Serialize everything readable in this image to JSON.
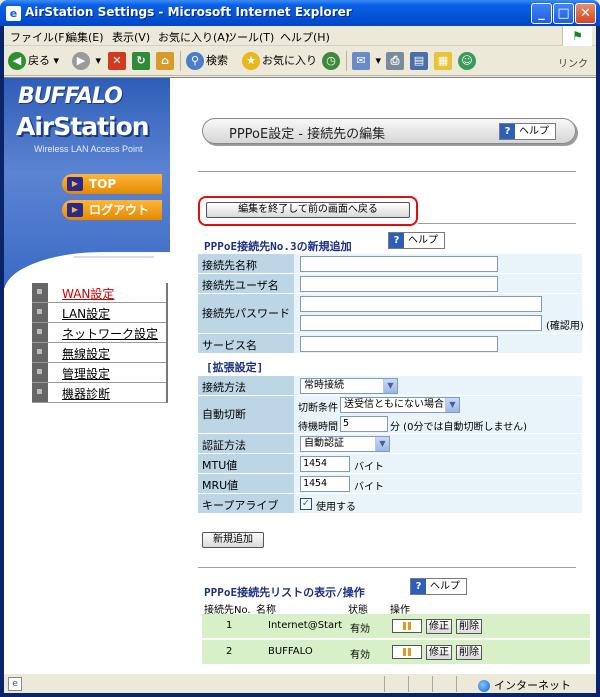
{
  "window": {
    "title": "AirStation Settings - Microsoft Internet Explorer",
    "icon": "ie-icon",
    "controls": [
      "minimize",
      "maximize",
      "close"
    ]
  },
  "menubar": {
    "items": [
      "ファイル(F)",
      "編集(E)",
      "表示(V)",
      "お気に入り(A)",
      "ツール(T)",
      "ヘルプ(H)"
    ]
  },
  "toolbar": {
    "back": "戻る",
    "search": "検索",
    "favorites": "お気に入り",
    "links": "リンク"
  },
  "sidebar": {
    "brand": "BUFFALO",
    "product": "AirStation",
    "tagline": "Wireless LAN Access Point",
    "top_button": "TOP",
    "logout_button": "ログアウト",
    "nav": [
      "WAN設定",
      "LAN設定",
      "ネットワーク設定",
      "無線設定",
      "管理設定",
      "機器診断"
    ],
    "active_index": 0
  },
  "header": {
    "title": "PPPoE設定 - 接続先の編集",
    "help": "ヘルプ"
  },
  "back_button": "編集を終了して前の画面へ戻る",
  "new_entry": {
    "title": "PPPoE接続先No.3の新規追加",
    "help": "ヘルプ",
    "fields": {
      "name_label": "接続先名称",
      "name_value": "",
      "user_label": "接続先ユーザ名",
      "user_value": "",
      "password_label": "接続先パスワード",
      "password_value": "",
      "password_confirm_value": "",
      "confirm_note": "(確認用)",
      "service_label": "サービス名",
      "service_value": ""
    },
    "extended_title": "[拡張設定]",
    "extended": {
      "connection_label": "接続方法",
      "connection_value": "常時接続",
      "autodisconnect_label": "自動切断",
      "condition_label": "切断条件",
      "condition_value": "送受信ともにない場合",
      "wait_label": "待機時間",
      "wait_value": "5",
      "wait_note": "分 (0分では自動切断しません)",
      "auth_label": "認証方法",
      "auth_value": "自動認証",
      "mtu_label": "MTU値",
      "mtu_value": "1454",
      "mtu_unit": "バイト",
      "mru_label": "MRU値",
      "mru_value": "1454",
      "mru_unit": "バイト",
      "keepalive_label": "キープアライブ",
      "keepalive_text": "使用する",
      "keepalive_checked": true
    },
    "add_button": "新規追加"
  },
  "list": {
    "title": "PPPoE接続先リストの表示/操作",
    "help": "ヘルプ",
    "headers": [
      "接続先No.",
      "名称",
      "状態",
      "操作"
    ],
    "rows": [
      {
        "no": "1",
        "name": "Internet@Start",
        "status": "有効",
        "edit": "修正",
        "delete": "削除"
      },
      {
        "no": "2",
        "name": "BUFFALO",
        "status": "有効",
        "edit": "修正",
        "delete": "削除"
      }
    ],
    "row_color": "#D8F0C8"
  },
  "status": {
    "zone": "インターネット"
  },
  "colors": {
    "label_bg": "#BCD6E6",
    "value_bg": "#E8F4FA",
    "title_blue": "#1C2F86",
    "active_nav": "#CC0000",
    "highlight": "#E01010"
  }
}
